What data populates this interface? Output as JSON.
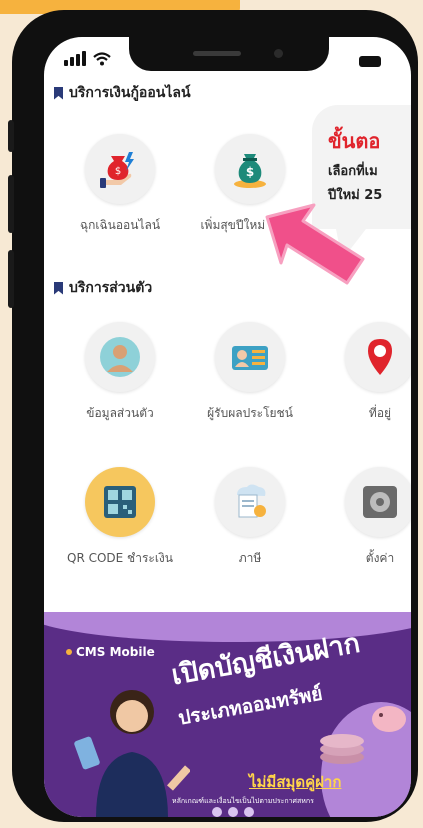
{
  "sections": {
    "loan": {
      "title": "บริการเงินกู้ออนไลน์",
      "items": [
        {
          "label": "ฉุกเฉินออนไลน์",
          "icon": "money-bag-hand-icon"
        },
        {
          "label": "เพิ่มสุขปีใหม่ 2568",
          "icon": "money-bag-icon"
        }
      ]
    },
    "personal": {
      "title": "บริการส่วนตัว",
      "items": [
        {
          "label": "ข้อมูลส่วนตัว",
          "icon": "user-profile-icon"
        },
        {
          "label": "ผู้รับผลประโยชน์",
          "icon": "beneficiary-icon"
        },
        {
          "label": "ที่อยู่",
          "icon": "location-pin-icon"
        },
        {
          "label": "QR CODE ชำระเงิน",
          "icon": "qr-code-icon"
        },
        {
          "label": "ภาษี",
          "icon": "tax-document-icon"
        },
        {
          "label": "ตั้งค่า",
          "icon": "settings-vault-icon"
        }
      ]
    }
  },
  "callout": {
    "line1": "ขั้นตอ",
    "line2": "เลือกที่เม",
    "line3": "ปีใหม่ 25"
  },
  "banner": {
    "brand": "CMS Mobile",
    "headline1": "เปิดบัญชีเงินฝาก",
    "headline2": "ประเภทออมทรัพย์",
    "tagline": "ไม่มีสมุดคู่ฝาก",
    "fine_print": "หลักเกณฑ์และเงื่อนไขเป็นไปตามประกาศสหกร"
  },
  "colors": {
    "accent_red": "#e0242c",
    "arrow_pink": "#f0508a",
    "banner_purple": "#5a2d86",
    "banner_yellow": "#ffd54a",
    "section_navy": "#2a3a78"
  }
}
